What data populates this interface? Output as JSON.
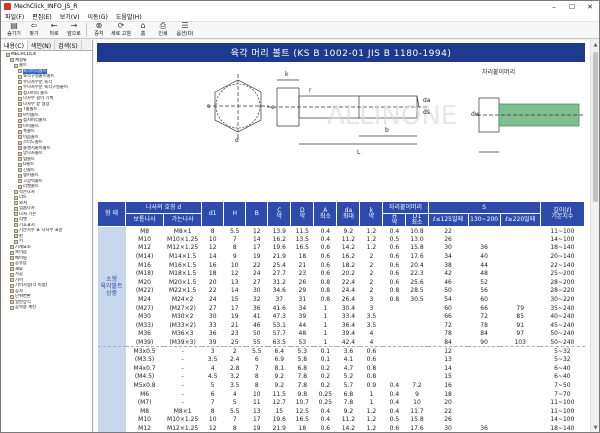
{
  "window": {
    "title": "MechClick_INFO_JS_R"
  },
  "menu": [
    "파일(F)",
    "편집(E)",
    "보기(V)",
    "이동(G)",
    "도움말(H)"
  ],
  "toolbar": [
    {
      "label": "숨기기",
      "icon": "hide-icon",
      "glyph": "▤"
    },
    {
      "label": "찾기",
      "icon": "locate-icon",
      "glyph": "⇦"
    },
    {
      "label": "뒤로",
      "icon": "back-icon",
      "glyph": "←"
    },
    {
      "label": "앞으로",
      "icon": "forward-icon",
      "glyph": "→"
    },
    {
      "label": "중지",
      "icon": "stop-icon",
      "glyph": "⊗"
    },
    {
      "label": "새로 고침",
      "icon": "refresh-icon",
      "glyph": "⟳"
    },
    {
      "label": "홈",
      "icon": "home-icon",
      "glyph": "⌂"
    },
    {
      "label": "인쇄",
      "icon": "print-icon",
      "glyph": "⎙"
    },
    {
      "label": "옵션(O)",
      "icon": "options-icon",
      "glyph": "☰"
    }
  ],
  "left_tabs": [
    "내용(C)",
    "색인(N)",
    "검색(S)"
  ],
  "tree": [
    {
      "label": "MECHCLICK",
      "indent": 1,
      "sel": false
    },
    {
      "label": "체결류",
      "indent": 2,
      "sel": false
    },
    {
      "label": "볼트",
      "indent": 3,
      "sel": false
    },
    {
      "label": "육각머리볼트",
      "indent": 4,
      "sel": true
    },
    {
      "label": "육각구멍붙이볼트",
      "indent": 4,
      "sel": false
    },
    {
      "label": "수나사부분 육각",
      "indent": 4,
      "sel": false
    },
    {
      "label": "수나사부분 육각구멍붙이",
      "indent": 4,
      "sel": false
    },
    {
      "label": "접시머리 볼트",
      "indent": 4,
      "sel": false
    },
    {
      "label": "나사부 길이 기록",
      "indent": 4,
      "sel": false
    },
    {
      "label": "나사부 끝 형상",
      "indent": 4,
      "sel": false
    },
    {
      "label": "T홈볼트",
      "indent": 4,
      "sel": false
    },
    {
      "label": "아이볼트",
      "indent": 4,
      "sel": false
    },
    {
      "label": "접시머리볼트",
      "indent": 4,
      "sel": false
    },
    {
      "label": "나비볼트",
      "indent": 4,
      "sel": false
    },
    {
      "label": "훅볼트",
      "indent": 4,
      "sel": false
    },
    {
      "label": "이음볼트",
      "indent": 4,
      "sel": false
    },
    {
      "label": "스터드볼트",
      "indent": 4,
      "sel": false
    },
    {
      "label": "플랜지붙이볼트",
      "indent": 4,
      "sel": false
    },
    {
      "label": "양나사볼트",
      "indent": 4,
      "sel": false
    },
    {
      "label": "탭볼트",
      "indent": 4,
      "sel": false
    },
    {
      "label": "U볼트",
      "indent": 4,
      "sel": false
    },
    {
      "label": "긴볼트",
      "indent": 4,
      "sel": false
    },
    {
      "label": "앵커볼트",
      "indent": 4,
      "sel": false
    },
    {
      "label": "고장력볼트",
      "indent": 4,
      "sel": false
    },
    {
      "label": "리벳볼트",
      "indent": 4,
      "sel": false
    },
    {
      "label": "작은나사",
      "indent": 3,
      "sel": false
    },
    {
      "label": "너트",
      "indent": 3,
      "sel": false
    },
    {
      "label": "와셔",
      "indent": 3,
      "sel": false
    },
    {
      "label": "멈춤나사",
      "indent": 3,
      "sel": false
    },
    {
      "label": "나사 기본",
      "indent": 3,
      "sel": false
    },
    {
      "label": "리벳",
      "indent": 3,
      "sel": false
    },
    {
      "label": "기호표시",
      "indent": 3,
      "sel": false
    },
    {
      "label": "기본치수 표 나사부 표준",
      "indent": 3,
      "sel": false
    },
    {
      "label": "핀",
      "indent": 3,
      "sel": false
    },
    {
      "label": "키",
      "indent": 3,
      "sel": false
    },
    {
      "label": "기계요소",
      "indent": 2,
      "sel": false
    },
    {
      "label": "축이음",
      "indent": 2,
      "sel": false
    },
    {
      "label": "베어링",
      "indent": 2,
      "sel": false
    },
    {
      "label": "공유압",
      "indent": 2,
      "sel": false
    },
    {
      "label": "재료",
      "indent": 2,
      "sel": false
    },
    {
      "label": "가공",
      "indent": 2,
      "sel": false
    },
    {
      "label": "기어",
      "indent": 2,
      "sel": false
    },
    {
      "label": "기어치형(각 이정)",
      "indent": 2,
      "sel": false
    },
    {
      "label": "공차",
      "indent": 2,
      "sel": false
    },
    {
      "label": "단위변환",
      "indent": 2,
      "sel": false
    },
    {
      "label": "일반상식",
      "indent": 2,
      "sel": false
    },
    {
      "label": "공학용 계산",
      "indent": 2,
      "sel": false
    }
  ],
  "page": {
    "title": "육각 머리 볼트 (KS B 1002-01 JIS B 1180-1994)",
    "drawing_label": "자리붙이머리",
    "dim_labels": [
      "d",
      "s",
      "b",
      "L",
      "k",
      "e",
      "r",
      "da",
      "ds",
      "dw"
    ]
  },
  "table": {
    "col_widths": [
      28,
      38,
      38,
      22,
      22,
      22,
      23,
      23,
      23,
      23,
      23,
      23,
      22,
      40,
      32,
      40,
      44
    ],
    "header1": [
      "형 태",
      "나사의 호칭 d",
      "",
      "d1",
      "H",
      "B",
      "C\n약",
      "D\n약",
      "A\n최소",
      "da\n최대",
      "k\n약",
      "자리붙이머리",
      "",
      "S",
      "",
      "",
      "길이(ℓ)\n기본치수"
    ],
    "header2": [
      "보통나사",
      "가는나사",
      "H\n약",
      "D1\n최소",
      "ℓ≤125일때",
      "130~200",
      "ℓ≥220일때"
    ],
    "group1_label": "소형\n육각볼트\n상중",
    "group2_label": "",
    "rows1": [
      [
        "M8",
        "M8×1",
        "8",
        "5.5",
        "12",
        "13.9",
        "11.5",
        "0.4",
        "9.2",
        "1.2",
        "0.4",
        "10.8",
        "22",
        "",
        "",
        "11~100"
      ],
      [
        "M10",
        "M10×1.25",
        "10",
        "7",
        "14",
        "16.2",
        "13.5",
        "0.4",
        "11.2",
        "1.2",
        "0.5",
        "13.0",
        "26",
        "",
        "",
        "14~100"
      ],
      [
        "M12",
        "M12×1.25",
        "12",
        "8",
        "17",
        "19.6",
        "16.5",
        "0.6",
        "14.2",
        "1.2",
        "0.6",
        "15.8",
        "30",
        "36",
        "",
        "18~140"
      ],
      [
        "(M14)",
        "M14×1.5",
        "14",
        "9",
        "19",
        "21.9",
        "18",
        "0.6",
        "16.2",
        "2",
        "0.6",
        "17.6",
        "34",
        "40",
        "",
        "20~140"
      ],
      [
        "M16",
        "M16×1.5",
        "16",
        "10",
        "22",
        "25.4",
        "21",
        "0.6",
        "18.2",
        "2",
        "0.6",
        "20.4",
        "38",
        "44",
        "",
        "22~140"
      ],
      [
        "(M18)",
        "M18×1.5",
        "18",
        "12",
        "24",
        "27.7",
        "23",
        "0.6",
        "20.2",
        "2",
        "0.6",
        "22.3",
        "42",
        "48",
        "",
        "25~200"
      ],
      [
        "M20",
        "M20×1.5",
        "20",
        "13",
        "27",
        "31.2",
        "26",
        "0.8",
        "22.4",
        "2",
        "0.6",
        "25.6",
        "46",
        "52",
        "",
        "28~200"
      ],
      [
        "(M22)",
        "M22×1.5",
        "22",
        "14",
        "30",
        "34.6",
        "29",
        "0.8",
        "24.4",
        "2",
        "0.8",
        "28.5",
        "50",
        "56",
        "",
        "28~220"
      ],
      [
        "M24",
        "M24×2",
        "24",
        "15",
        "32",
        "37",
        "31",
        "0.8",
        "26.4",
        "3",
        "0.8",
        "30.5",
        "54",
        "60",
        "",
        "30~220"
      ],
      [
        "(M27)",
        "(M27×2)",
        "27",
        "17",
        "36",
        "41.6",
        "34",
        "1",
        "30.4",
        "3",
        "",
        "",
        "60",
        "66",
        "79",
        "35~240"
      ],
      [
        "M30",
        "M30×2",
        "30",
        "19",
        "41",
        "47.3",
        "39",
        "1",
        "33.4",
        "3.5",
        "",
        "",
        "66",
        "72",
        "85",
        "40~240"
      ],
      [
        "(M33)",
        "(M33×2)",
        "33",
        "21",
        "46",
        "53.1",
        "44",
        "1",
        "36.4",
        "3.5",
        "",
        "",
        "72",
        "78",
        "91",
        "45~240"
      ],
      [
        "M36",
        "M36×3",
        "36",
        "23",
        "50",
        "57.7",
        "48",
        "1",
        "39.4",
        "4",
        "",
        "",
        "78",
        "84",
        "97",
        "50~240"
      ],
      [
        "(M39)",
        "(M39×3)",
        "39",
        "25",
        "55",
        "63.5",
        "53",
        "1",
        "42.4",
        "4",
        "",
        "",
        "84",
        "90",
        "103",
        "50~240"
      ]
    ],
    "rows2": [
      [
        "M3x0.5",
        "-",
        "3",
        "2",
        "5.5",
        "6.4",
        "5.3",
        "0.1",
        "3.6",
        "0.6",
        "",
        "",
        "12",
        "",
        "",
        "5~32"
      ],
      [
        "(M3.5)",
        "-",
        "3.5",
        "2.4",
        "6",
        "6.9",
        "5.8",
        "0.1",
        "4.1",
        "0.6",
        "",
        "",
        "13",
        "",
        "",
        "5~32"
      ],
      [
        "M4x0.7",
        "-",
        "4",
        "2.8",
        "7",
        "8.1",
        "6.8",
        "0.2",
        "4.7",
        "0.8",
        "",
        "",
        "14",
        "",
        "",
        "6~40"
      ],
      [
        "(M4.5)",
        "-",
        "4.5",
        "3.2",
        "8",
        "9.2",
        "7.8",
        "0.2",
        "5.2",
        "0.8",
        "",
        "",
        "15",
        "",
        "",
        "6~40"
      ],
      [
        "M5x0.8",
        "-",
        "5",
        "3.5",
        "8",
        "9.2",
        "7.8",
        "0.2",
        "5.7",
        "0.9",
        "0.4",
        "7.2",
        "16",
        "",
        "",
        "7~50"
      ],
      [
        "M6",
        "-",
        "6",
        "4",
        "10",
        "11.5",
        "9.8",
        "0.25",
        "6.8",
        "1",
        "0.4",
        "9",
        "18",
        "",
        "",
        "7~70"
      ],
      [
        "(M7)",
        "-",
        "7",
        "5",
        "11",
        "12.7",
        "10.7",
        "0.25",
        "7.8",
        "1",
        "0.4",
        "10",
        "20",
        "",
        "",
        "11~100"
      ],
      [
        "M8",
        "M8×1",
        "8",
        "5.5",
        "13",
        "15",
        "12.5",
        "0.4",
        "9.2",
        "1.2",
        "0.4",
        "11.7",
        "22",
        "",
        "",
        "11~100"
      ],
      [
        "M10",
        "M10×1.25",
        "10",
        "7",
        "17",
        "19.6",
        "16.5",
        "0.4",
        "11.2",
        "1.2",
        "0.5",
        "15.8",
        "26",
        "",
        "",
        "14~100"
      ],
      [
        "M12",
        "M12×1.25",
        "12",
        "8",
        "19",
        "21.9",
        "18",
        "0.6",
        "14.2",
        "1.2",
        "0.6",
        "17.6",
        "30",
        "36",
        "",
        "18~140"
      ]
    ]
  }
}
